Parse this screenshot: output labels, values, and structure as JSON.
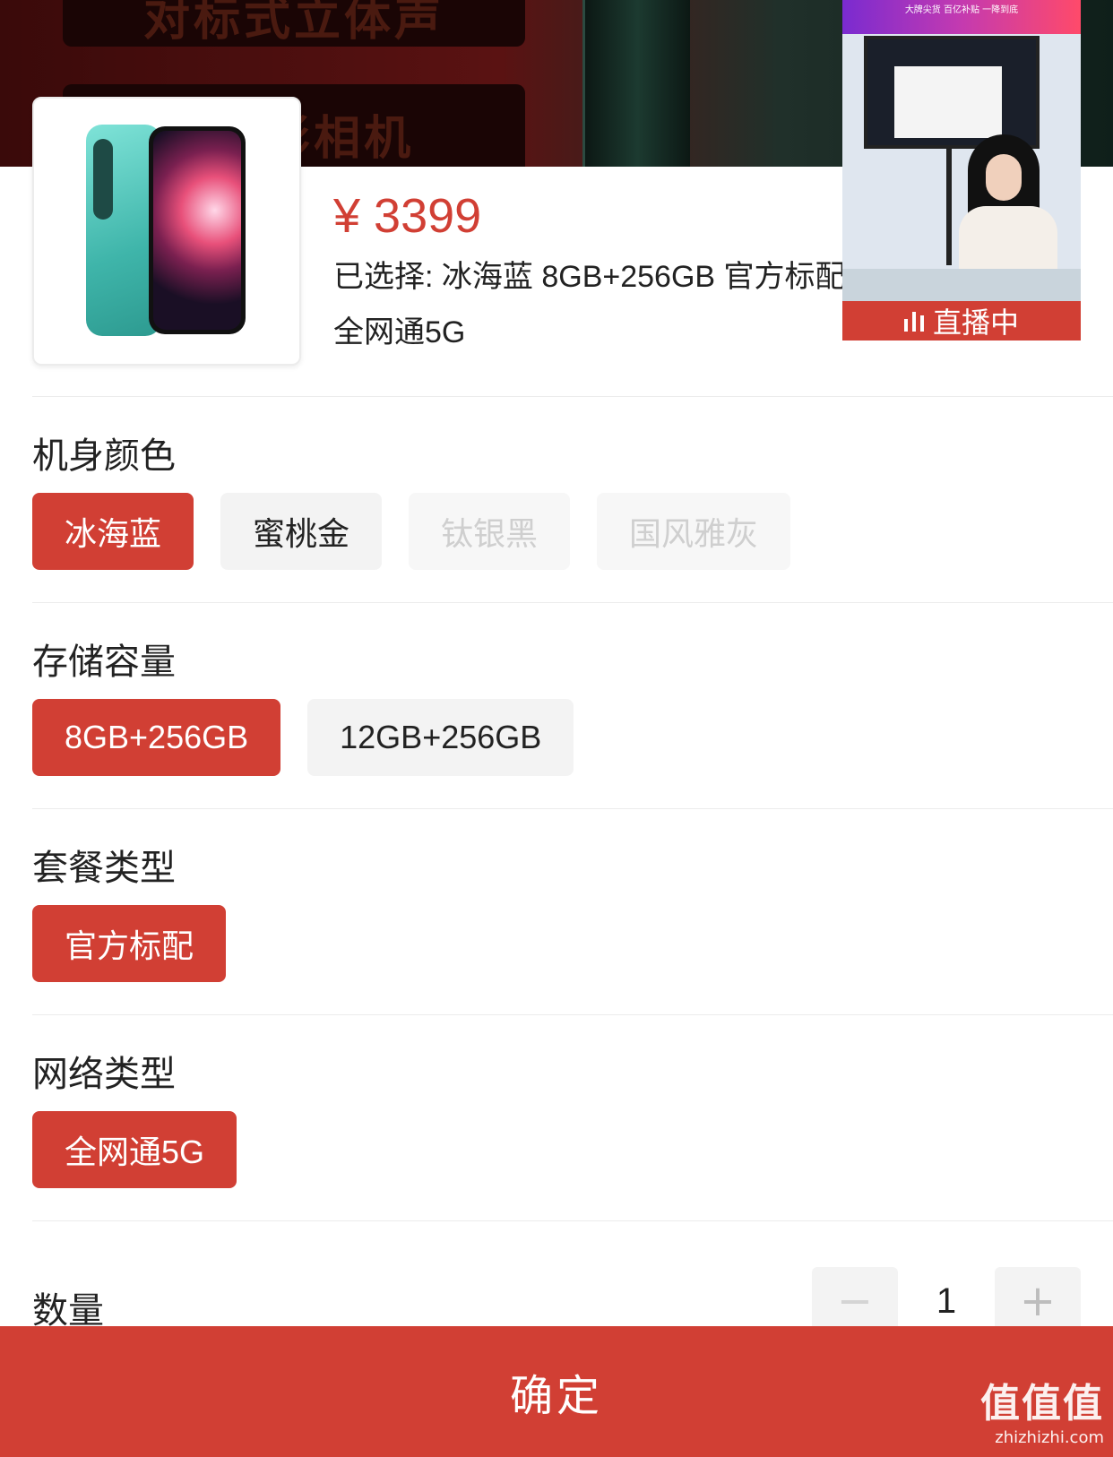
{
  "background": {
    "banner_top": "对标式立体声",
    "banner_mid": "K电影相机"
  },
  "product": {
    "price": "¥ 3399",
    "selected_text": "已选择: 冰海蓝 8GB+256GB 官方标配 全网通5G"
  },
  "live": {
    "top_text": "大牌尖货 百亿补贴 一降到底",
    "badge": "直播中"
  },
  "groups": [
    {
      "title": "机身颜色",
      "options": [
        {
          "label": "冰海蓝",
          "state": "selected"
        },
        {
          "label": "蜜桃金",
          "state": "normal"
        },
        {
          "label": "钛银黑",
          "state": "disabled"
        },
        {
          "label": "国风雅灰",
          "state": "disabled"
        }
      ]
    },
    {
      "title": "存储容量",
      "options": [
        {
          "label": "8GB+256GB",
          "state": "selected"
        },
        {
          "label": "12GB+256GB",
          "state": "normal"
        }
      ]
    },
    {
      "title": "套餐类型",
      "options": [
        {
          "label": "官方标配",
          "state": "selected"
        }
      ]
    },
    {
      "title": "网络类型",
      "options": [
        {
          "label": "全网通5G",
          "state": "selected"
        }
      ]
    }
  ],
  "quantity": {
    "label": "数量",
    "value": "1",
    "minus_symbol": "−",
    "plus_symbol": "+"
  },
  "confirm_label": "确定",
  "watermark": {
    "logo": "值值值",
    "url": "zhizhizhi.com"
  },
  "colors": {
    "accent": "#d13f34",
    "option_bg": "#f3f3f3",
    "disabled_text": "#cfcfcf"
  }
}
